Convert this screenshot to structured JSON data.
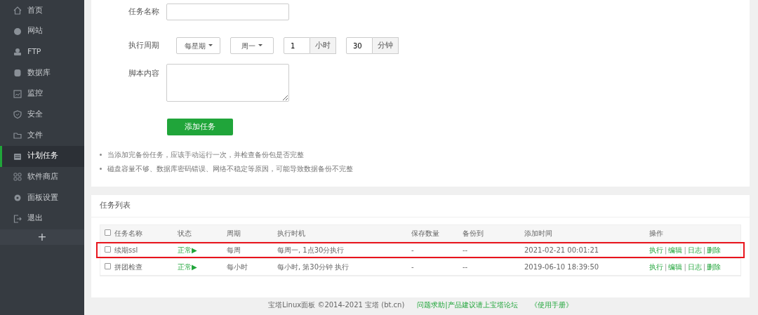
{
  "sidebar": {
    "items": [
      {
        "label": "首页",
        "selected": false
      },
      {
        "label": "网站",
        "selected": false
      },
      {
        "label": "FTP",
        "selected": false
      },
      {
        "label": "数据库",
        "selected": false
      },
      {
        "label": "监控",
        "selected": false
      },
      {
        "label": "安全",
        "selected": false
      },
      {
        "label": "文件",
        "selected": false
      },
      {
        "label": "计划任务",
        "selected": true
      },
      {
        "label": "软件商店",
        "selected": false
      },
      {
        "label": "面板设置",
        "selected": false
      },
      {
        "label": "退出",
        "selected": false
      }
    ],
    "add_button": "+"
  },
  "form": {
    "name_label": "任务名称",
    "period_label": "执行周期",
    "period_type": "每星期",
    "weekday": "周一",
    "hour": "1",
    "hour_unit": "小时",
    "minute": "30",
    "minute_unit": "分钟",
    "script_label": "脚本内容",
    "submit": "添加任务",
    "notes": [
      "当添加完备份任务，应该手动运行一次，并检查备份包是否完整",
      "磁盘容量不够、数据库密码错误、网络不稳定等原因，可能导致数据备份不完整"
    ]
  },
  "task_list": {
    "title": "任务列表",
    "all_checked": false,
    "action_separator": "|",
    "columns": [
      "任务名称",
      "状态",
      "周期",
      "执行时机",
      "保存数量",
      "备份到",
      "添加时间",
      "操作"
    ],
    "rows": [
      {
        "checked": false,
        "highlighted": true,
        "name": "续期ssl",
        "status": "正常▶",
        "period": "每周",
        "timing": "每周一, 1点30分执行",
        "keep": "-",
        "backup_to": "--",
        "added": "2021-02-21 00:01:21",
        "actions": [
          "执行",
          "编辑",
          "日志",
          "删除"
        ]
      },
      {
        "checked": false,
        "highlighted": false,
        "name": "拼团检查",
        "status": "正常▶",
        "period": "每小时",
        "timing": "每小时, 第30分钟 执行",
        "keep": "-",
        "backup_to": "--",
        "added": "2019-06-10 18:39:50",
        "actions": [
          "执行",
          "编辑",
          "日志",
          "删除"
        ]
      }
    ]
  },
  "footer": {
    "copyright": "宝塔Linux面板 ©2014-2021 宝塔 (bt.cn)",
    "forum_link": "问题求助|产品建议请上宝塔论坛",
    "manual_link": "《使用手册》"
  }
}
